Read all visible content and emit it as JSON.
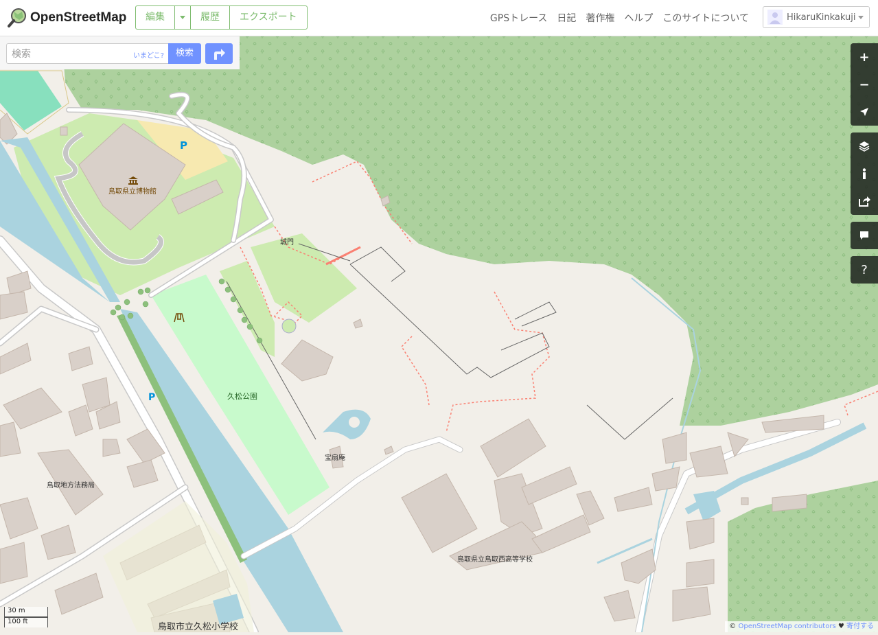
{
  "header": {
    "site_name": "OpenStreetMap",
    "edit_label": "編集",
    "history_label": "履歴",
    "export_label": "エクスポート",
    "nav": [
      "GPSトレース",
      "日記",
      "著作権",
      "ヘルプ",
      "このサイトについて"
    ],
    "username": "HikaruKinkakuji"
  },
  "search": {
    "placeholder": "検索",
    "where_label": "いまどこ?",
    "button_label": "検索"
  },
  "map_labels": {
    "museum": "鳥取県立博物館",
    "gate": "城門",
    "park": "久松公園",
    "hoseian": "宝扇庵",
    "legal_bureau": "鳥取地方法務局",
    "high_school": "鳥取県立鳥取西高等学校",
    "elementary": "鳥取市立久松小学校",
    "parking_1": "P",
    "parking_2": "P"
  },
  "controls": {
    "zoom_in": "+",
    "zoom_out": "−",
    "query": "?"
  },
  "scale": {
    "metric": "30 m",
    "imperial": "100 ft"
  },
  "attribution": {
    "prefix": "©",
    "link": "OpenStreetMap contributors",
    "heart": "♥",
    "donate": "寄付する"
  },
  "colors": {
    "accent_green": "#7ebc6f",
    "button_blue": "#7092ff",
    "forest": "#add19e",
    "park": "#c8facc",
    "grass": "#cdebb0",
    "water": "#aad3df",
    "building": "#d9d0c9",
    "land": "#f2efe9"
  }
}
